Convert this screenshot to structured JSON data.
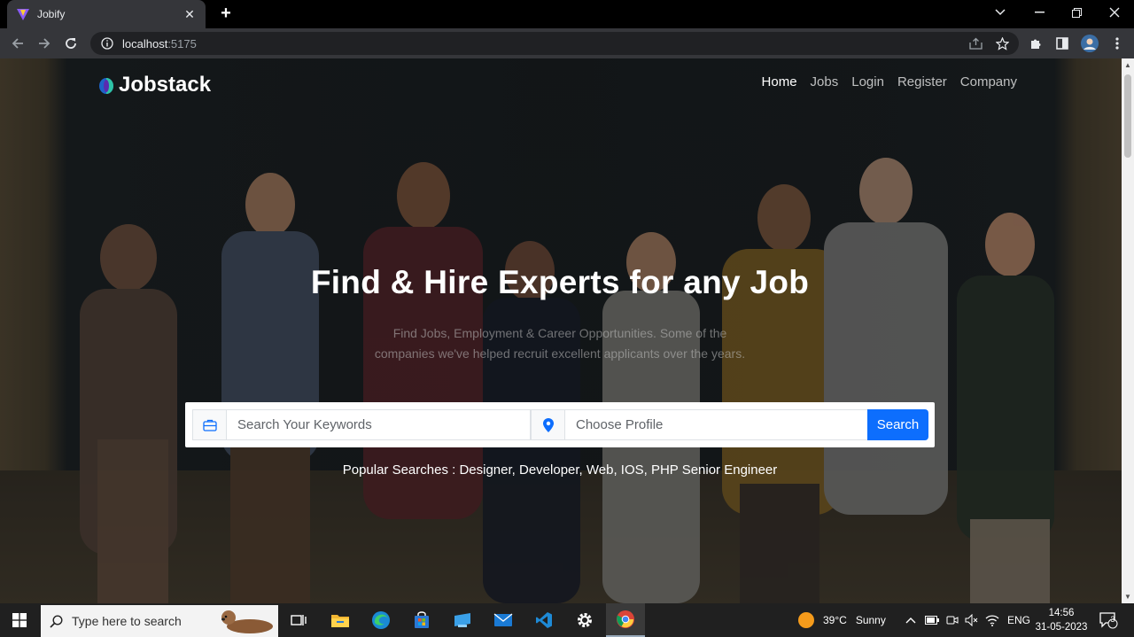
{
  "browser": {
    "tab_title": "Jobify",
    "url_host": "localhost",
    "url_port": ":5175"
  },
  "site": {
    "logo_text": "Jobstack",
    "nav": [
      {
        "label": "Home",
        "active": true
      },
      {
        "label": "Jobs",
        "active": false
      },
      {
        "label": "Login",
        "active": false
      },
      {
        "label": "Register",
        "active": false
      },
      {
        "label": "Company",
        "active": false
      }
    ],
    "hero_title": "Find & Hire Experts for any Job",
    "hero_subtitle": "Find Jobs, Employment & Career Opportunities. Some of the companies we've helped recruit excellent applicants over the years.",
    "search": {
      "keywords_placeholder": "Search Your Keywords",
      "profile_placeholder": "Choose Profile",
      "button_label": "Search"
    },
    "popular_searches": "Popular Searches : Designer, Developer, Web, IOS, PHP Senior Engineer"
  },
  "taskbar": {
    "search_placeholder": "Type here to search",
    "weather_temp": "39°C",
    "weather_text": "Sunny",
    "language": "ENG",
    "time": "14:56",
    "date": "31-05-2023",
    "notification_count": "3"
  },
  "colors": {
    "accent": "#0d6efd",
    "chrome_dark": "#35363a"
  }
}
